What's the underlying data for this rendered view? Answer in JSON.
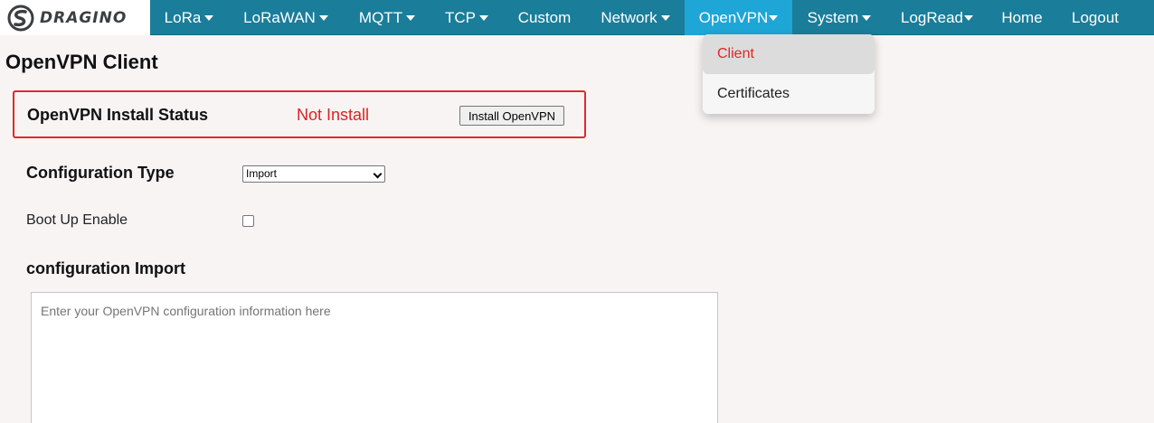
{
  "brand": {
    "logo_text": "DRAGINO"
  },
  "colors": {
    "nav_bg": "#1a7d9a",
    "nav_active": "#1ea6d6",
    "accent_red": "#e01f1f"
  },
  "nav": {
    "items": [
      {
        "label": "LoRa",
        "has_caret": true
      },
      {
        "label": "LoRaWAN",
        "has_caret": true
      },
      {
        "label": "MQTT",
        "has_caret": true
      },
      {
        "label": "TCP",
        "has_caret": true
      },
      {
        "label": "Custom",
        "has_caret": false
      },
      {
        "label": "Network",
        "has_caret": true
      },
      {
        "label": "OpenVPN",
        "has_caret": true,
        "active": true
      },
      {
        "label": "System",
        "has_caret": true
      },
      {
        "label": "LogRead",
        "has_caret": true
      },
      {
        "label": "Home",
        "has_caret": false
      },
      {
        "label": "Logout",
        "has_caret": false
      }
    ]
  },
  "dropdown": {
    "items": [
      {
        "label": "Client",
        "selected": true
      },
      {
        "label": "Certificates",
        "selected": false
      }
    ]
  },
  "page": {
    "title": "OpenVPN Client",
    "status": {
      "label": "OpenVPN Install Status",
      "value": "Not Install",
      "button_label": "Install OpenVPN"
    },
    "config_type": {
      "label": "Configuration Type",
      "selected": "Import"
    },
    "boot_up": {
      "label": "Boot Up Enable",
      "checked": false
    },
    "import": {
      "title": "configuration Import",
      "placeholder": "Enter your OpenVPN configuration information here",
      "value": ""
    }
  }
}
